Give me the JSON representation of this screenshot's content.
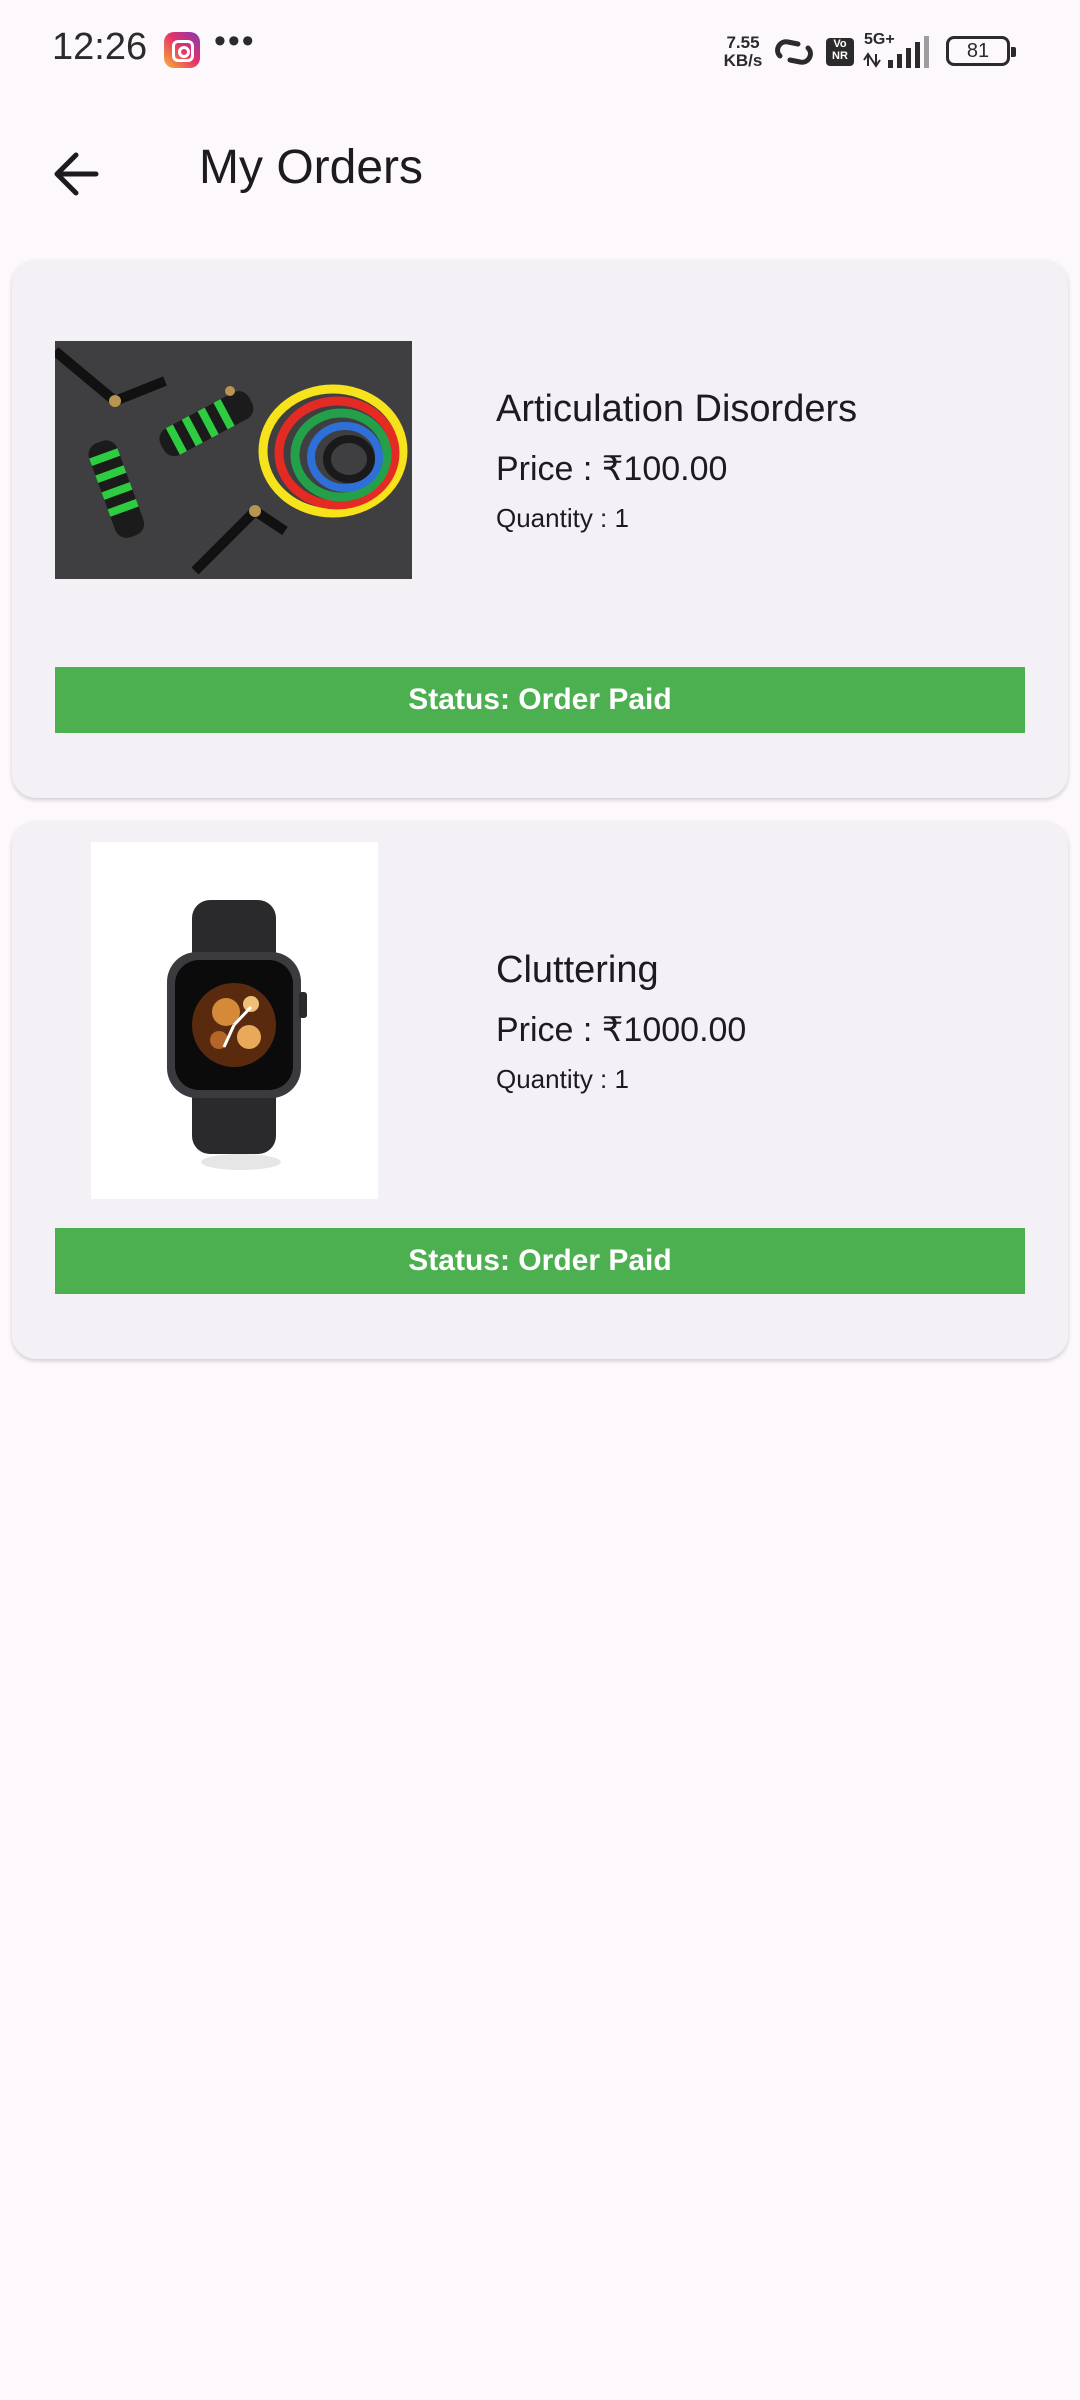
{
  "statusbar": {
    "time": "12:26",
    "app_icon": "instagram-icon",
    "more": "•••",
    "speed_value": "7.55",
    "speed_unit": "KB/s",
    "volte": "Vo\nNR",
    "network": "5G+",
    "battery": "81"
  },
  "appbar": {
    "title": "My Orders",
    "back_icon": "arrow-back-icon"
  },
  "orders": [
    {
      "name": "Articulation Disorders",
      "price": "Price : ₹100.00",
      "quantity": "Quantity : 1",
      "status": "Status: Order Paid",
      "image": "resistance-bands-image"
    },
    {
      "name": "Cluttering",
      "price": "Price : ₹1000.00",
      "quantity": "Quantity : 1",
      "status": "Status: Order Paid",
      "image": "smartwatch-image"
    }
  ],
  "colors": {
    "background": "#fdf8fc",
    "card": "#f3f0f6",
    "status_green": "#4caf50"
  }
}
